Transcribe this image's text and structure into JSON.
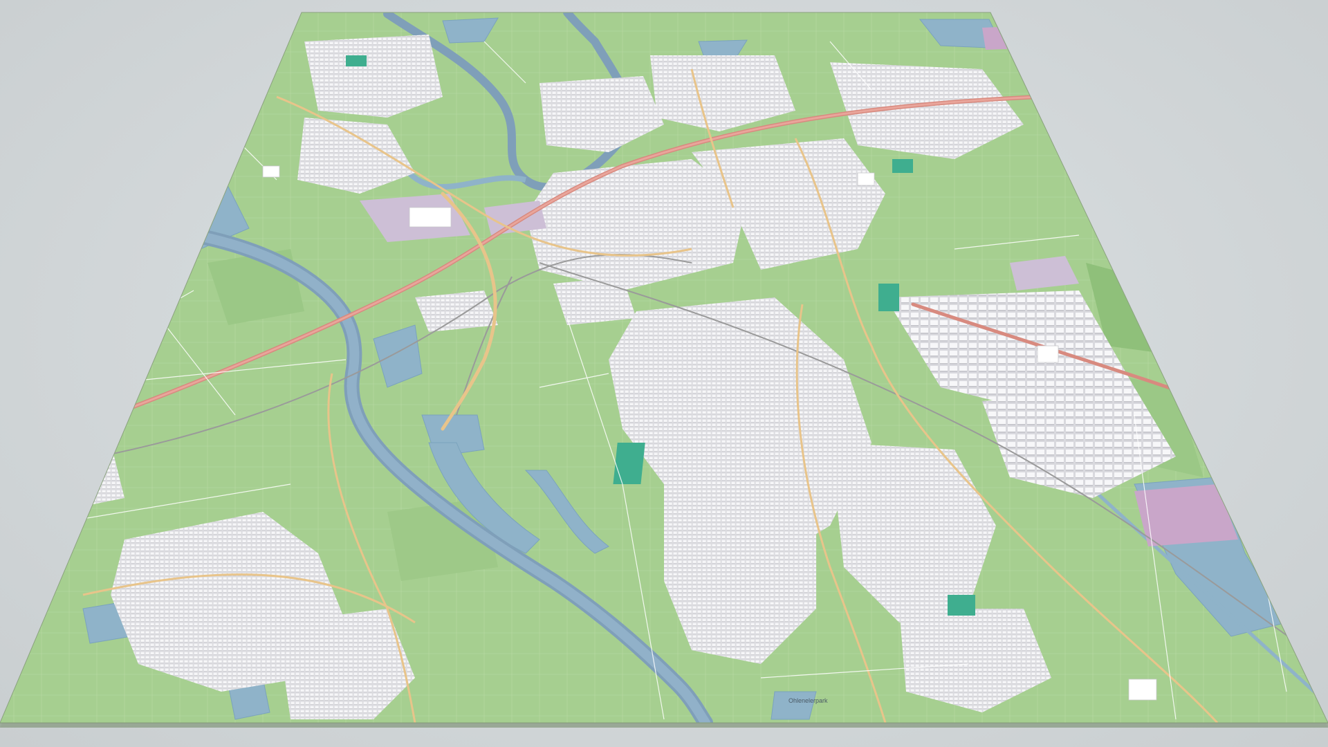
{
  "scene": {
    "description_kind": "3D perspective map tile",
    "colors": {
      "background": "#d4d9db",
      "land": "#a6cf90",
      "land_dark": "#97c483",
      "water": "#8fb3c9",
      "water_edge": "#7aa3bd",
      "river": "#7f9fb9",
      "urban": "#e6e6e9",
      "building": "#f4f4f6",
      "industrial": "#cdbfd6",
      "industrial_pink": "#c9a6c9",
      "sports": "#3fae8f",
      "road_major": "#e8c48a",
      "road_motorway": "#d88a7f",
      "road_minor": "#ffffff",
      "rail": "#9a9a9a"
    }
  },
  "labels": {
    "park_bottom": "Ohlenelerpark"
  }
}
